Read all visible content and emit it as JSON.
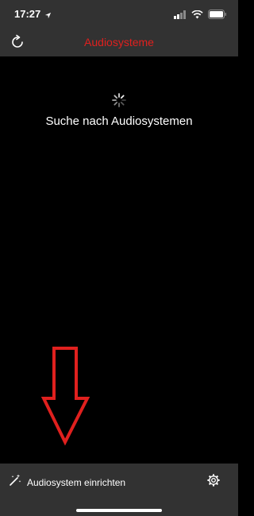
{
  "status_bar": {
    "time": "17:27",
    "icons": [
      "location-arrow-icon",
      "signal-icon",
      "wifi-icon",
      "battery-icon"
    ]
  },
  "nav": {
    "title": "Audiosysteme",
    "left_icon": "refresh-icon"
  },
  "main": {
    "loading_icon": "spinner-icon",
    "status_text": "Suche nach Audiosystemen",
    "annotation_icon": "red-down-arrow-icon"
  },
  "bottom_bar": {
    "setup_icon": "magic-wand-icon",
    "setup_label": "Audiosystem einrichten",
    "settings_icon": "gear-icon"
  },
  "colors": {
    "accent": "#e0201e",
    "bar_bg": "#323232",
    "content_bg": "#000000",
    "text": "#ffffff"
  }
}
